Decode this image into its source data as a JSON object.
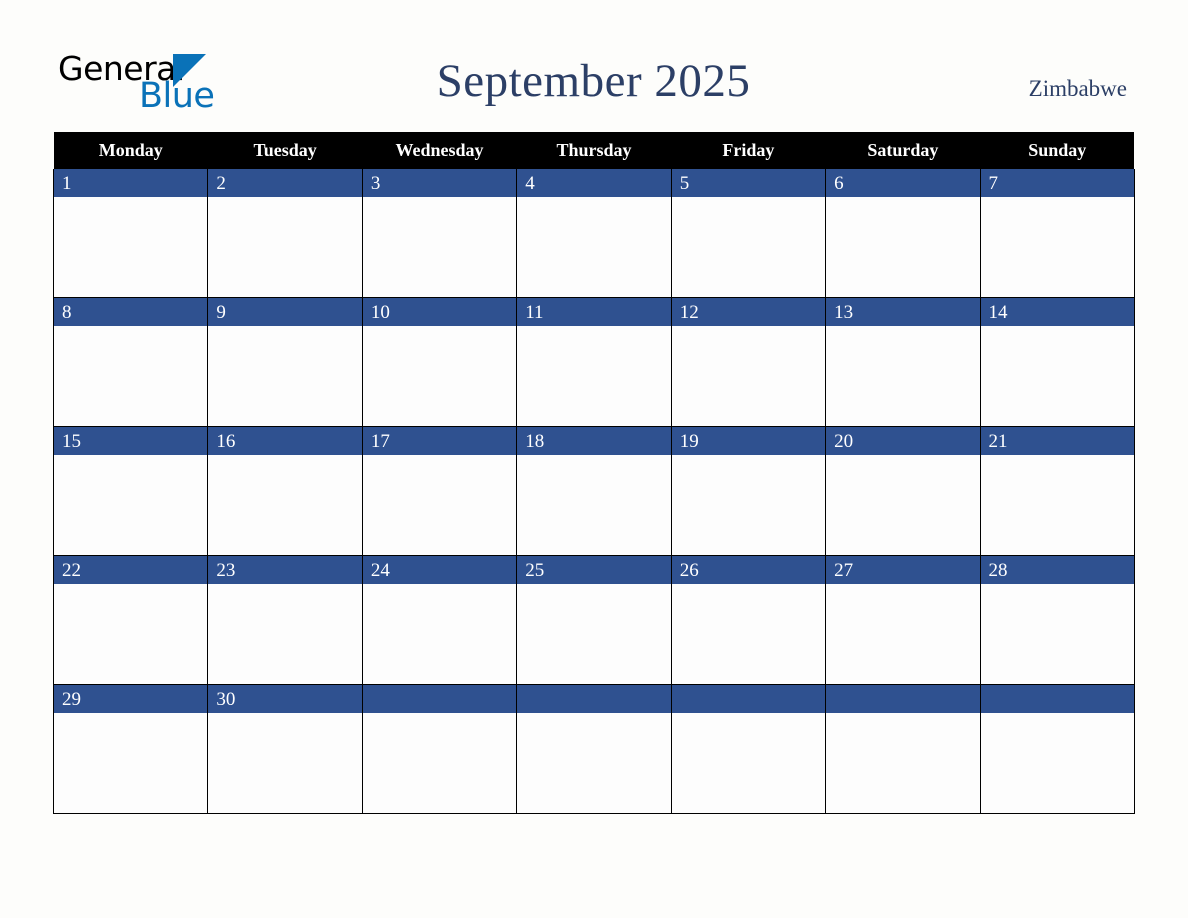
{
  "brand": {
    "word_one": "General",
    "word_two": "Blue",
    "triangle_icon": "triangle-icon",
    "color_black": "#000000",
    "color_blue": "#0a72b8"
  },
  "header": {
    "title": "September 2025",
    "country": "Zimbabwe",
    "title_color": "#2c3f66"
  },
  "calendar": {
    "month": "September",
    "year": "2025",
    "week_start": "Monday",
    "header_background": "#000000",
    "band_color": "#2f5190",
    "cell_background": "#fdfdfd",
    "weekdays": [
      "Monday",
      "Tuesday",
      "Wednesday",
      "Thursday",
      "Friday",
      "Saturday",
      "Sunday"
    ],
    "weeks": [
      [
        "1",
        "2",
        "3",
        "4",
        "5",
        "6",
        "7"
      ],
      [
        "8",
        "9",
        "10",
        "11",
        "12",
        "13",
        "14"
      ],
      [
        "15",
        "16",
        "17",
        "18",
        "19",
        "20",
        "21"
      ],
      [
        "22",
        "23",
        "24",
        "25",
        "26",
        "27",
        "28"
      ],
      [
        "29",
        "30",
        "",
        "",
        "",
        "",
        ""
      ]
    ]
  }
}
